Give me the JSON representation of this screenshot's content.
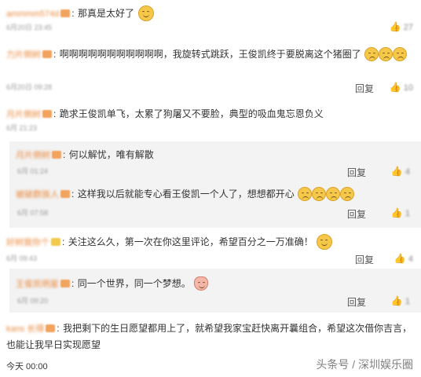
{
  "comments": [
    {
      "name": "ammmm574d",
      "text": "那真是太好了",
      "time": "6月20日 23:45",
      "likes": "27"
    },
    {
      "name": "力片倒树",
      "text": "啊啊啊啊啊啊啊啊啊啊啊，我旋转式跳跃，王俊凯终于要脱离这个猪圈了",
      "time": "6月20日 09:28",
      "reply": "回复",
      "likes": "10"
    },
    {
      "name": "月片倒树",
      "text": "跪求王俊凯单飞，太累了狗屠又不要脸，典型的吸血鬼忘恩负义",
      "time": "6月 21:23"
    },
    {
      "name": "月片倒树",
      "text": "何以解忧，唯有解散",
      "time": "6月 01:24",
      "reply": "回复",
      "likes": "4"
    },
    {
      "name": "被破群族人",
      "text": "这样我以后就能专心看王俊凯一个人了，想想都开心",
      "time": "6月 07:58",
      "reply": "回复",
      "likes": "1"
    },
    {
      "name": "好树我你个",
      "text": "关注这么久，第一次在你这里评论，希望百分之一万准确！",
      "time": "6月 09:43",
      "reply": "回复",
      "likes": "4"
    },
    {
      "name": "王俊凯明星",
      "text": "同一个世界，同一个梦想。",
      "time": "6月 09:20",
      "reply": "回复",
      "likes": "1"
    },
    {
      "name": "kans 长得",
      "text": "我把剩下的生日愿望都用上了，就希望我家宝赶快离开曩组合，希望这次借你吉言，也能让我早日实现愿望"
    }
  ],
  "footer": {
    "time": "今天 00:00"
  },
  "watermark": "头条号 / 深圳娱乐圈"
}
